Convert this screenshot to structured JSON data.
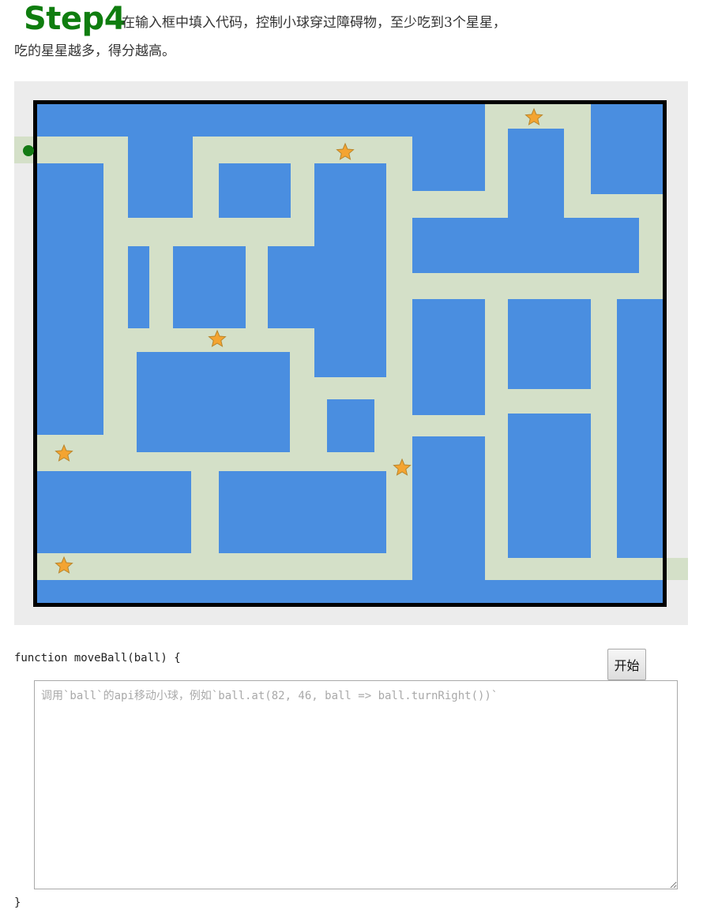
{
  "header": {
    "step_title": "Step4",
    "instruction_line1": "在输入框中填入代码，控制小球穿过障碍物，至少吃到3个星星，",
    "instruction_line2": "吃的星星越多，得分越高。"
  },
  "game": {
    "colors": {
      "panel_background": "#ececec",
      "water": "#4a8ee0",
      "path": "#d4e0c8",
      "border": "#000000",
      "ball": "#137a13",
      "star_fill": "#f4a431",
      "star_stroke": "#b8862d"
    },
    "ball_icon": "green-ball",
    "star_icon": "star",
    "star_count": 6
  },
  "code_editor": {
    "function_header": "function moveBall(ball) {",
    "function_footer": "}",
    "start_button_label": "开始",
    "placeholder": "调用`ball`的api移动小球，例如`ball.at(82, 46, ball => ball.turnRight())`",
    "value": ""
  }
}
